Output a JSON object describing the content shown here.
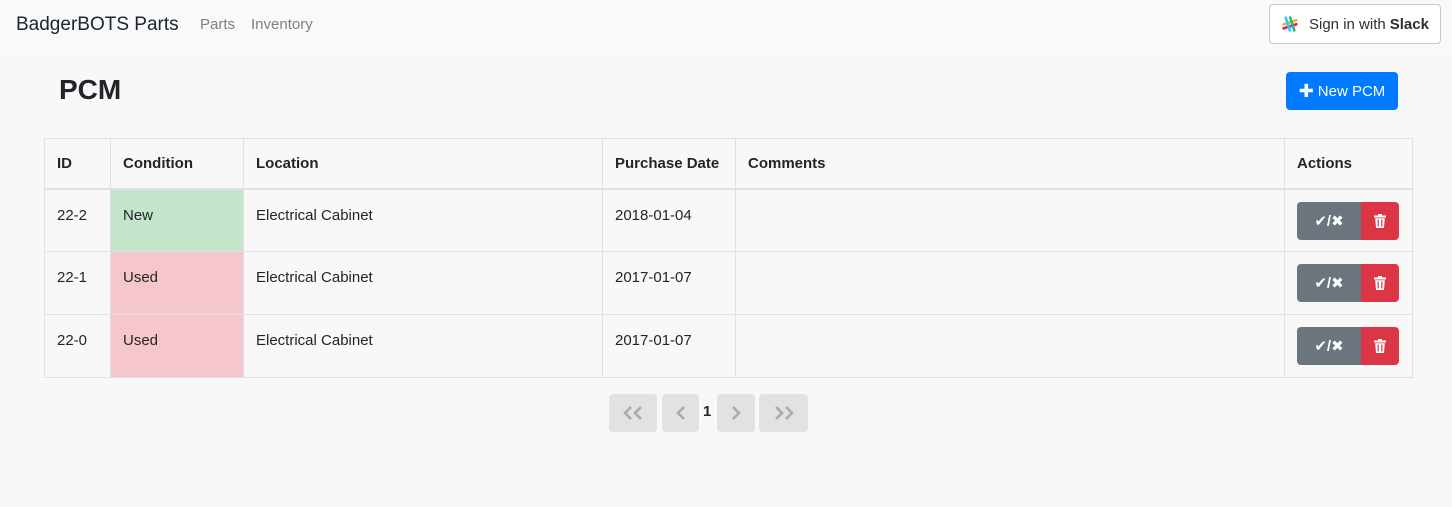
{
  "navbar": {
    "brand": "BadgerBOTS Parts",
    "links": [
      "Parts",
      "Inventory"
    ],
    "slack_prefix": "Sign in with",
    "slack_label": "Slack"
  },
  "page": {
    "title": "PCM",
    "new_button": "New PCM"
  },
  "table": {
    "columns": [
      "ID",
      "Condition",
      "Location",
      "Purchase Date",
      "Comments",
      "Actions"
    ],
    "rows": [
      {
        "id": "22-2",
        "condition": "New",
        "location": "Electrical Cabinet",
        "purchase_date": "2018-01-04",
        "comments": ""
      },
      {
        "id": "22-1",
        "condition": "Used",
        "location": "Electrical Cabinet",
        "purchase_date": "2017-01-07",
        "comments": ""
      },
      {
        "id": "22-0",
        "condition": "Used",
        "location": "Electrical Cabinet",
        "purchase_date": "2017-01-07",
        "comments": ""
      }
    ],
    "toggle_label": "✔/✖"
  },
  "pagination": {
    "current_page": "1"
  },
  "colors": {
    "primary": "#007bff",
    "new_condition": "#c3e6cb",
    "used_condition": "#f5c6cb",
    "secondary": "#6c757d",
    "danger": "#dc3545"
  },
  "icons": {
    "slack": "slack-icon",
    "plus": "plus-icon",
    "check_cross": "check-cross-icon",
    "trash": "trash-icon",
    "first": "double-chevron-left-icon",
    "prev": "chevron-left-icon",
    "next": "chevron-right-icon",
    "last": "double-chevron-right-icon"
  }
}
